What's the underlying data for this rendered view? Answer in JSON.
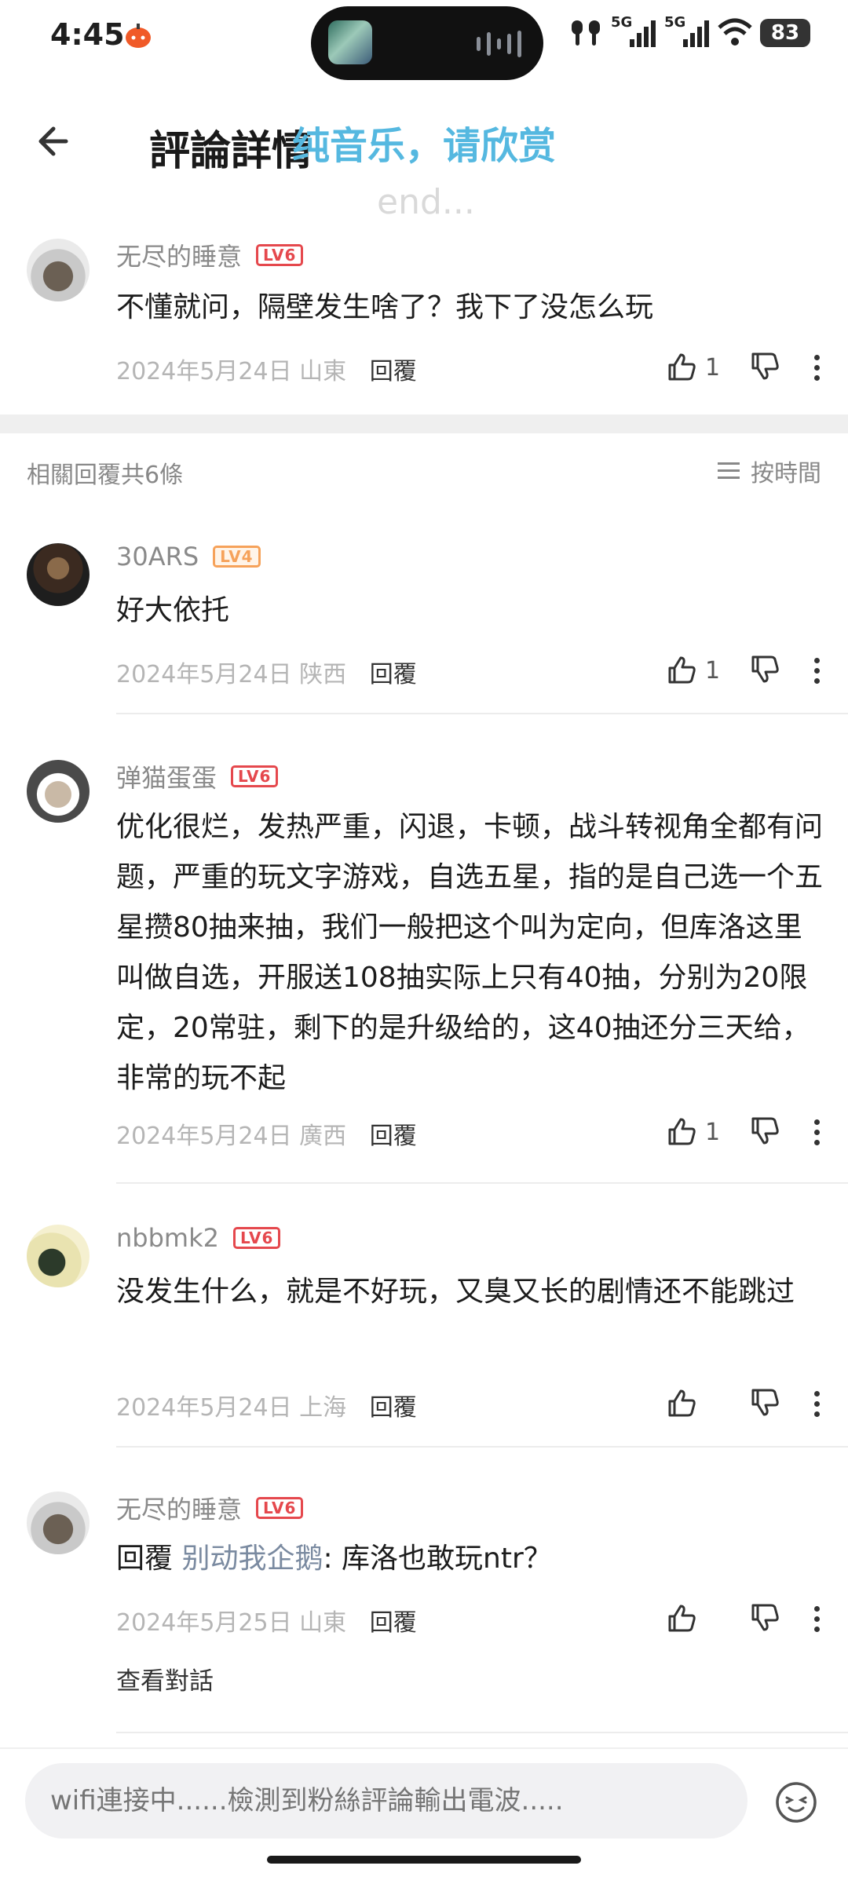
{
  "status_bar": {
    "time": "4:45",
    "net1": "5G",
    "net2": "5G",
    "battery": "83"
  },
  "header": {
    "title": "評論詳情",
    "overlay_caption": "纯音乐，请欣赏",
    "overlay_end": "end..."
  },
  "main_comment": {
    "username": "无尽的睡意",
    "level": "LV6",
    "text": "不懂就问，隔壁发生啥了？我下了没怎么玩",
    "date_location": "2024年5月24日 山東",
    "reply_label": "回覆",
    "likes": "1"
  },
  "replies_header": {
    "count_label": "相關回覆共6條",
    "sort_label": "按時間"
  },
  "replies": [
    {
      "username": "30ARS",
      "level": "LV4",
      "text": "好大依托",
      "date_location": "2024年5月24日 陕西",
      "reply_label": "回覆",
      "likes": "1"
    },
    {
      "username": "弹猫蛋蛋",
      "level": "LV6",
      "text": "优化很烂，发热严重，闪退，卡顿，战斗转视角全都有问题，严重的玩文字游戏，自选五星，指的是自己选一个五星攒80抽来抽，我们一般把这个叫为定向，但库洛这里叫做自选，开服送108抽实际上只有40抽，分别为20限定，20常驻，剩下的是升级给的，这40抽还分三天给，非常的玩不起",
      "date_location": "2024年5月24日 廣西",
      "reply_label": "回覆",
      "likes": "1"
    },
    {
      "username": "nbbmk2",
      "level": "LV6",
      "text": "没发生什么，就是不好玩，又臭又长的剧情还不能跳过",
      "date_location": "2024年5月24日 上海",
      "reply_label": "回覆",
      "likes": ""
    },
    {
      "username": "无尽的睡意",
      "level": "LV6",
      "reply_prefix": "回覆",
      "reply_target": "别动我企鹅",
      "text": ": 库洛也敢玩ntr？",
      "date_location": "2024年5月25日 山東",
      "reply_label": "回覆",
      "likes": "",
      "see_conversation": "查看對話"
    }
  ],
  "comment_box": {
    "placeholder": "wifi連接中......檢測到粉絲評論輸出電波....."
  },
  "colors": {
    "level_red": "#e5484d",
    "level_orange": "#f6a25a",
    "overlay_blue": "#55b8e0"
  }
}
